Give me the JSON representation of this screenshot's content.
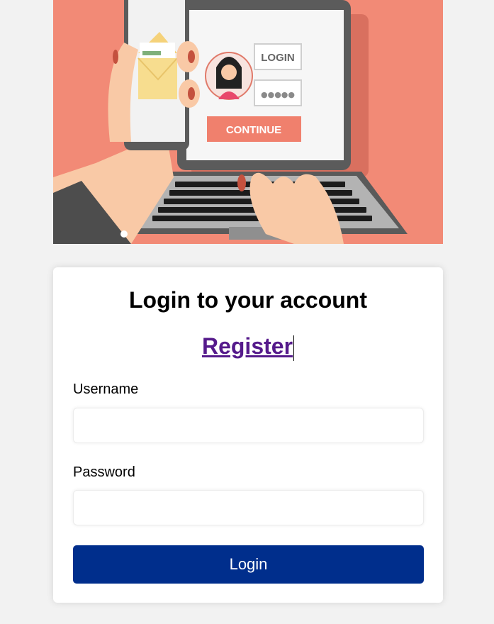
{
  "hero": {
    "image_name": "login-illustration",
    "screen_login_label": "LOGIN",
    "screen_password_mask": "●●●●●",
    "screen_continue_label": "CONTINUE",
    "phone_password_mask": "●●●●●●"
  },
  "form": {
    "title": "Login to your account",
    "register_link": "Register",
    "username_label": "Username",
    "username_value": "",
    "password_label": "Password",
    "password_value": "",
    "submit_label": "Login"
  },
  "colors": {
    "page_background": "#f2f2f2",
    "hero_background": "#f28a76",
    "link": "#551a8b",
    "button": "#002e8c"
  }
}
